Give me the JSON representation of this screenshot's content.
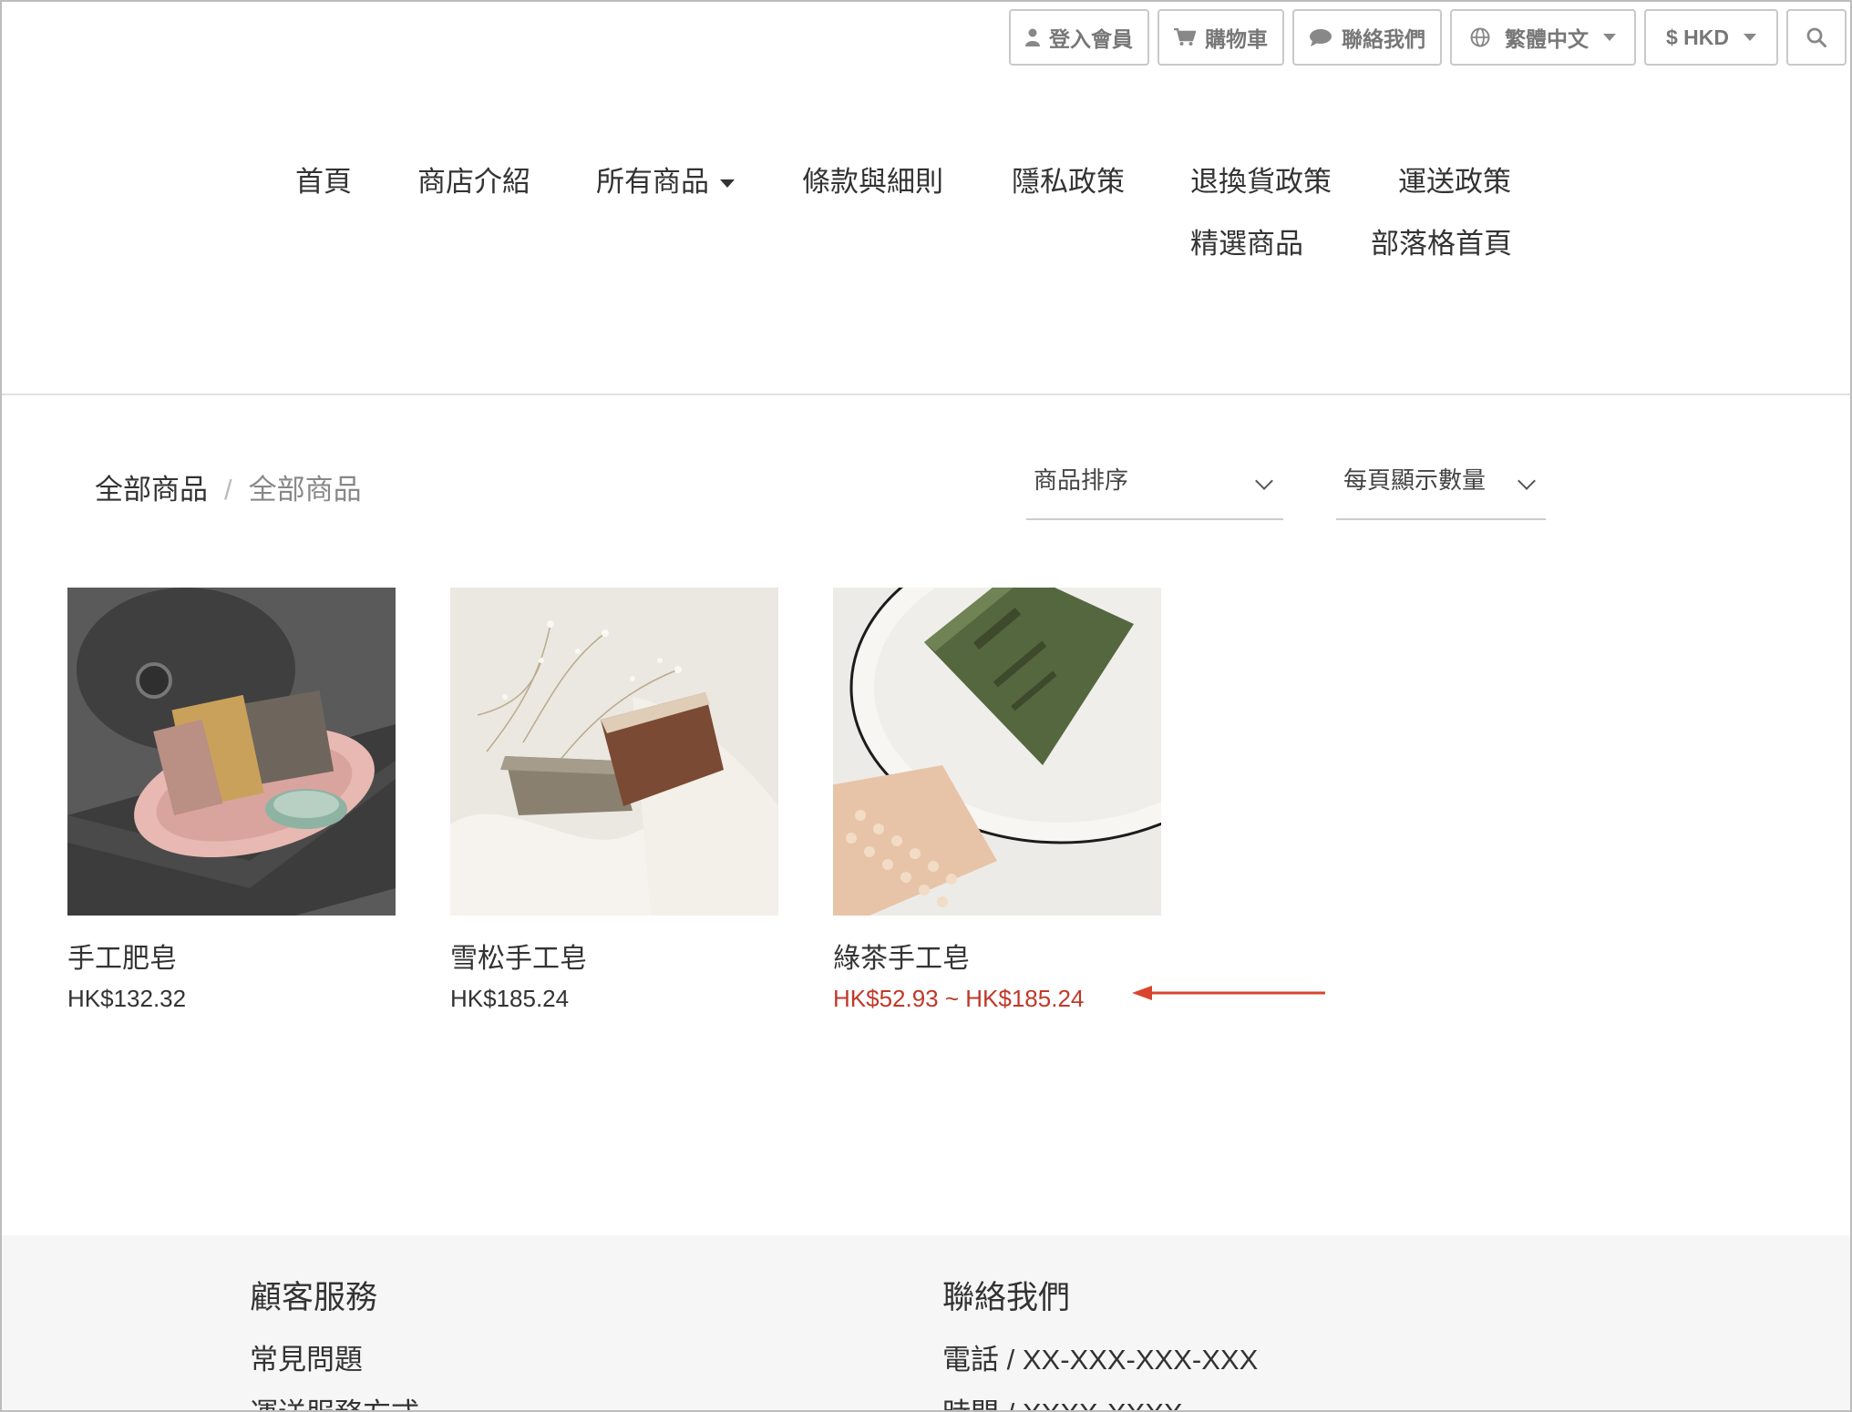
{
  "topbar": {
    "login": "登入會員",
    "cart": "購物車",
    "contact": "聯絡我們",
    "language": "繁體中文",
    "currency": "$ HKD",
    "icons": [
      "user-icon",
      "cart-icon",
      "chat-icon",
      "globe-icon",
      "search-icon"
    ]
  },
  "nav": {
    "home": "首頁",
    "about": "商店介紹",
    "all_products": "所有商品",
    "terms": "條款與細則",
    "privacy": "隱私政策",
    "returns": "退換貨政策",
    "shipping": "運送政策",
    "featured": "精選商品",
    "blog": "部落格首頁"
  },
  "breadcrumb": {
    "root": "全部商品",
    "separator": "/",
    "current": "全部商品"
  },
  "sort": {
    "sort_label": "商品排序",
    "per_page_label": "每頁顯示數量"
  },
  "products": [
    {
      "name": "手工肥皂",
      "price": "HK$132.32"
    },
    {
      "name": "雪松手工皂",
      "price": "HK$185.24"
    },
    {
      "name": "綠茶手工皂",
      "price": "HK$52.93 ~ HK$185.24"
    }
  ],
  "footer": {
    "service_title": "顧客服務",
    "faq": "常見問題",
    "shipping_methods": "運送服務方式",
    "contact_title": "聯絡我們",
    "phone": "電話 / XX-XXX-XXX-XXX",
    "hours": "時間 / XXXX-XXXX"
  },
  "colors": {
    "sale_price": "#c0392b",
    "annotation_arrow": "#d9442f",
    "footer_bg": "#f6f6f6"
  }
}
